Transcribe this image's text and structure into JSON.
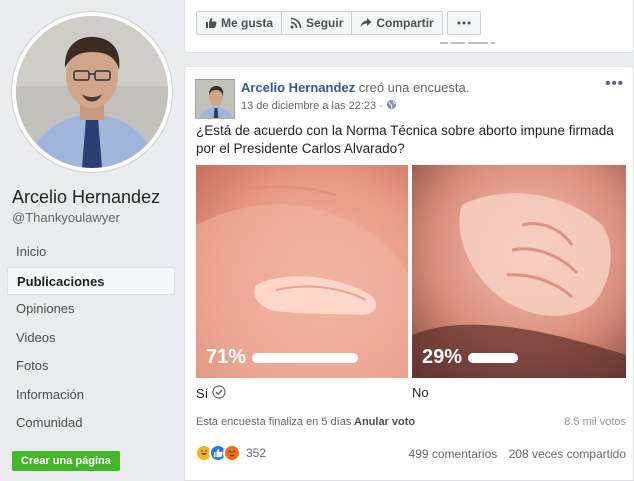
{
  "profile": {
    "name": "Arcelio Hernandez",
    "handle": "@Thankyoulawyer"
  },
  "nav": {
    "items": [
      {
        "label": "Inicio",
        "active": false
      },
      {
        "label": "Publicaciones",
        "active": true
      },
      {
        "label": "Opiniones",
        "active": false
      },
      {
        "label": "Videos",
        "active": false
      },
      {
        "label": "Fotos",
        "active": false
      },
      {
        "label": "Información",
        "active": false
      },
      {
        "label": "Comunidad",
        "active": false
      }
    ],
    "create_page": "Crear una página"
  },
  "top_actions": {
    "like": "Me gusta",
    "follow": "Seguir",
    "share": "Compartir"
  },
  "post": {
    "author": "Arcelio Hernandez",
    "action": "creó una encuesta.",
    "date": "13 de diciembre a las 22:23 ·",
    "question": "¿Está de acuerdo con la Norma Técnica sobre aborto impune firmada por el Presidente Carlos Alvarado?",
    "options": [
      {
        "label": "Sí",
        "percent_label": "71%",
        "percent": 71
      },
      {
        "label": "No",
        "percent_label": "29%",
        "percent": 29
      }
    ],
    "ends": "Esta encuesta finaliza en 5 días",
    "cancel_vote": "Anular voto",
    "votes": "8.5 mil votos",
    "reaction_count": "352",
    "comments": "499 comentarios",
    "shares": "208 veces compartido"
  },
  "colors": {
    "link": "#365899",
    "green_button": "#42b72a",
    "background": "#e9ebee"
  }
}
